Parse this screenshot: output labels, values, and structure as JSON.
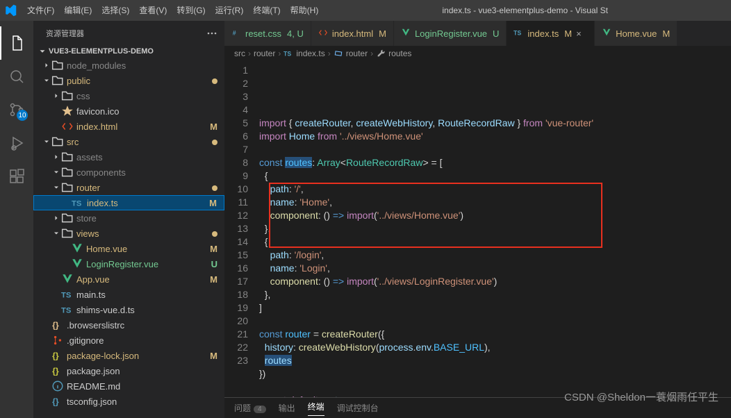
{
  "titlebar": {
    "title": "index.ts - vue3-elementplus-demo - Visual St",
    "menu": [
      "文件(F)",
      "编辑(E)",
      "选择(S)",
      "查看(V)",
      "转到(G)",
      "运行(R)",
      "终端(T)",
      "帮助(H)"
    ]
  },
  "activitybar": {
    "scm_badge": "10"
  },
  "sidebar": {
    "header": "资源管理器",
    "project": "VUE3-ELEMENTPLUS-DEMO",
    "tree": [
      {
        "depth": 0,
        "chev": ">",
        "icon": "folder",
        "label": "node_modules",
        "dim": true
      },
      {
        "depth": 0,
        "chev": "v",
        "icon": "folder",
        "label": "public",
        "cls": "mod",
        "dot": "#d7ba7d"
      },
      {
        "depth": 1,
        "chev": ">",
        "icon": "folder",
        "label": "css",
        "dim": true
      },
      {
        "depth": 1,
        "icon": "star",
        "label": "favicon.ico",
        "iconColor": "#e2c08d"
      },
      {
        "depth": 1,
        "icon": "html",
        "label": "index.html",
        "cls": "mod",
        "status": "M",
        "iconColor": "#e44d26"
      },
      {
        "depth": 0,
        "chev": "v",
        "icon": "folder",
        "label": "src",
        "cls": "mod",
        "dot": "#d7ba7d"
      },
      {
        "depth": 1,
        "chev": ">",
        "icon": "folder",
        "label": "assets",
        "dim": true
      },
      {
        "depth": 1,
        "chev": "v",
        "icon": "folder",
        "label": "components",
        "dim": true
      },
      {
        "depth": 1,
        "chev": "v",
        "icon": "folder",
        "label": "router",
        "cls": "mod",
        "dot": "#d7ba7d"
      },
      {
        "depth": 2,
        "icon": "ts",
        "label": "index.ts",
        "cls": "mod",
        "status": "M",
        "selected": true,
        "iconColor": "#519aba"
      },
      {
        "depth": 1,
        "chev": ">",
        "icon": "folder",
        "label": "store",
        "dim": true
      },
      {
        "depth": 1,
        "chev": "v",
        "icon": "folder",
        "label": "views",
        "cls": "mod",
        "dot": "#d7ba7d"
      },
      {
        "depth": 2,
        "icon": "vue",
        "label": "Home.vue",
        "cls": "mod",
        "status": "M",
        "iconColor": "#41b883"
      },
      {
        "depth": 2,
        "icon": "vue",
        "label": "LoginRegister.vue",
        "cls": "unt",
        "status": "U",
        "iconColor": "#41b883"
      },
      {
        "depth": 1,
        "icon": "vue",
        "label": "App.vue",
        "cls": "mod",
        "status": "M",
        "iconColor": "#41b883"
      },
      {
        "depth": 1,
        "icon": "ts",
        "label": "main.ts",
        "iconColor": "#519aba"
      },
      {
        "depth": 1,
        "icon": "ts",
        "label": "shims-vue.d.ts",
        "iconColor": "#519aba"
      },
      {
        "depth": 0,
        "icon": "brace",
        "label": ".browserslistrc",
        "iconColor": "#e2c08d"
      },
      {
        "depth": 0,
        "icon": "git",
        "label": ".gitignore",
        "iconColor": "#e44d26"
      },
      {
        "depth": 0,
        "icon": "brace",
        "label": "package-lock.json",
        "cls": "mod",
        "status": "M",
        "iconColor": "#cbcb41"
      },
      {
        "depth": 0,
        "icon": "brace",
        "label": "package.json",
        "iconColor": "#cbcb41"
      },
      {
        "depth": 0,
        "icon": "info",
        "label": "README.md",
        "iconColor": "#519aba"
      },
      {
        "depth": 0,
        "icon": "brace",
        "label": "tsconfig.json",
        "iconColor": "#519aba"
      }
    ]
  },
  "tabs": [
    {
      "icon": "css",
      "label": "reset.css",
      "suffix": "4, U",
      "color": "#73c991",
      "iconColor": "#519aba"
    },
    {
      "icon": "html",
      "label": "index.html",
      "suffix": "M",
      "color": "#d7ba7d",
      "iconColor": "#e44d26"
    },
    {
      "icon": "vue",
      "label": "LoginRegister.vue",
      "suffix": "U",
      "color": "#73c991",
      "iconColor": "#41b883"
    },
    {
      "icon": "ts",
      "label": "index.ts",
      "suffix": "M",
      "color": "#d7ba7d",
      "active": true,
      "close": true,
      "iconColor": "#519aba"
    },
    {
      "icon": "vue",
      "label": "Home.vue",
      "suffix": "M",
      "color": "#d7ba7d",
      "iconColor": "#41b883"
    }
  ],
  "breadcrumb": [
    "src",
    "router",
    "index.ts",
    "router",
    "routes"
  ],
  "breadcrumb_icons": [
    "",
    "",
    "ts",
    "var",
    "wrench"
  ],
  "code": {
    "lines": [
      [
        [
          "k",
          "import"
        ],
        [
          "p",
          " { "
        ],
        [
          "v",
          "createRouter"
        ],
        [
          "p",
          ", "
        ],
        [
          "v",
          "createWebHistory"
        ],
        [
          "p",
          ", "
        ],
        [
          "v",
          "RouteRecordRaw"
        ],
        [
          "p",
          " } "
        ],
        [
          "k",
          "from"
        ],
        [
          "p",
          " "
        ],
        [
          "s",
          "'vue-router'"
        ]
      ],
      [
        [
          "k",
          "import"
        ],
        [
          "p",
          " "
        ],
        [
          "v",
          "Home"
        ],
        [
          "p",
          " "
        ],
        [
          "k",
          "from"
        ],
        [
          "p",
          " "
        ],
        [
          "s",
          "'../views/Home.vue'"
        ]
      ],
      [],
      [
        [
          "b",
          "const"
        ],
        [
          "p",
          " "
        ],
        [
          "c",
          "routes",
          "sel"
        ],
        [
          "p",
          ": "
        ],
        [
          "t",
          "Array"
        ],
        [
          "p",
          "<"
        ],
        [
          "t",
          "RouteRecordRaw"
        ],
        [
          "p",
          "> = ["
        ]
      ],
      [
        [
          "p",
          "  {"
        ]
      ],
      [
        [
          "p",
          "    "
        ],
        [
          "v",
          "path"
        ],
        [
          "p",
          ": "
        ],
        [
          "s",
          "'/'"
        ],
        [
          "p",
          ","
        ]
      ],
      [
        [
          "p",
          "    "
        ],
        [
          "v",
          "name"
        ],
        [
          "p",
          ": "
        ],
        [
          "s",
          "'Home'"
        ],
        [
          "p",
          ","
        ]
      ],
      [
        [
          "p",
          "    "
        ],
        [
          "f",
          "component"
        ],
        [
          "p",
          ": () "
        ],
        [
          "b",
          "=>"
        ],
        [
          "p",
          " "
        ],
        [
          "k",
          "import"
        ],
        [
          "p",
          "("
        ],
        [
          "s",
          "'../views/Home.vue'"
        ],
        [
          "p",
          ")"
        ]
      ],
      [
        [
          "p",
          "  },"
        ]
      ],
      [
        [
          "p",
          "  {"
        ]
      ],
      [
        [
          "p",
          "    "
        ],
        [
          "v",
          "path"
        ],
        [
          "p",
          ": "
        ],
        [
          "s",
          "'/login'"
        ],
        [
          "p",
          ","
        ]
      ],
      [
        [
          "p",
          "    "
        ],
        [
          "v",
          "name"
        ],
        [
          "p",
          ": "
        ],
        [
          "s",
          "'Login'"
        ],
        [
          "p",
          ","
        ]
      ],
      [
        [
          "p",
          "    "
        ],
        [
          "f",
          "component"
        ],
        [
          "p",
          ": () "
        ],
        [
          "b",
          "=>"
        ],
        [
          "p",
          " "
        ],
        [
          "k",
          "import"
        ],
        [
          "p",
          "("
        ],
        [
          "s",
          "'../views/LoginRegister.vue'"
        ],
        [
          "p",
          ")"
        ]
      ],
      [
        [
          "p",
          "  },"
        ]
      ],
      [
        [
          "p",
          "]"
        ]
      ],
      [],
      [
        [
          "b",
          "const"
        ],
        [
          "p",
          " "
        ],
        [
          "c",
          "router"
        ],
        [
          "p",
          " = "
        ],
        [
          "f",
          "createRouter"
        ],
        [
          "p",
          "({"
        ]
      ],
      [
        [
          "p",
          "  "
        ],
        [
          "v",
          "history"
        ],
        [
          "p",
          ": "
        ],
        [
          "f",
          "createWebHistory"
        ],
        [
          "p",
          "("
        ],
        [
          "v",
          "process"
        ],
        [
          "p",
          "."
        ],
        [
          "v",
          "env"
        ],
        [
          "p",
          "."
        ],
        [
          "c",
          "BASE_URL"
        ],
        [
          "p",
          "),"
        ]
      ],
      [
        [
          "p",
          "  "
        ],
        [
          "v",
          "routes",
          "sel"
        ]
      ],
      [
        [
          "p",
          "})"
        ]
      ],
      [],
      [
        [
          "k",
          "export"
        ],
        [
          "p",
          " "
        ],
        [
          "k",
          "default"
        ],
        [
          "p",
          " "
        ],
        [
          "v",
          "router"
        ]
      ],
      []
    ]
  },
  "panel": {
    "tabs": [
      {
        "label": "问题",
        "count": "4"
      },
      {
        "label": "输出"
      },
      {
        "label": "终端",
        "active": true
      },
      {
        "label": "调试控制台"
      }
    ]
  },
  "watermark": "CSDN @Sheldon一蓑烟雨任平生"
}
